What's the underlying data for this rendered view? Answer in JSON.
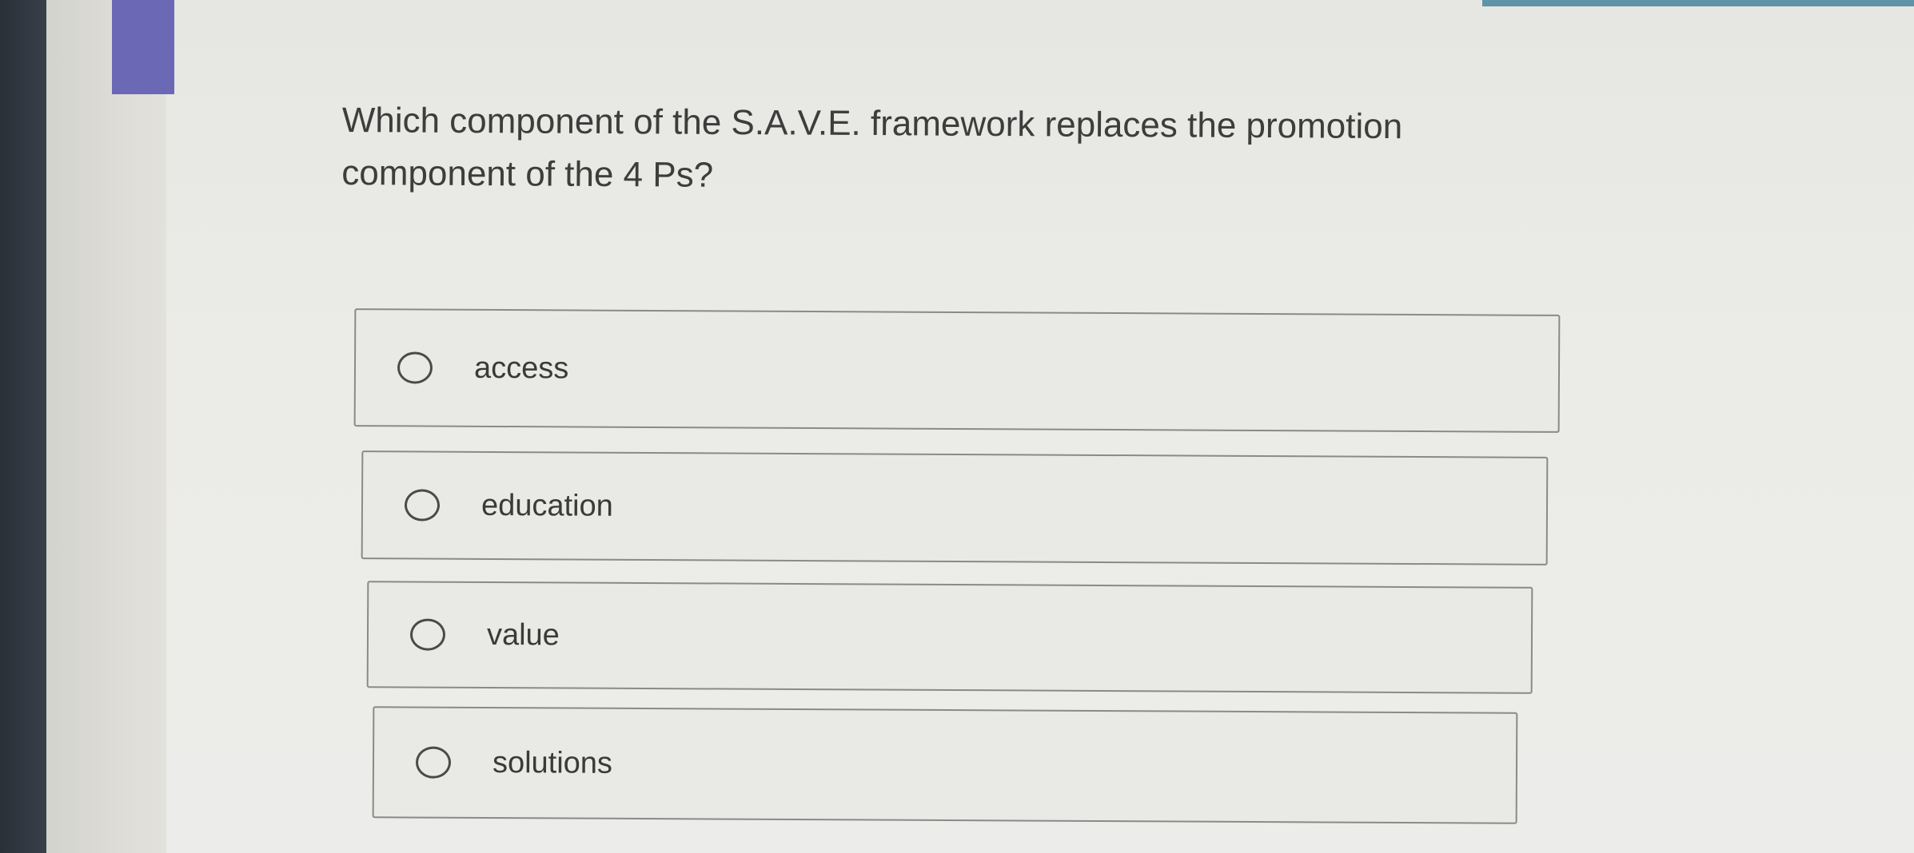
{
  "question": {
    "text_line": "Which component of the S.A.V.E. framework replaces the promotion component of the 4 Ps?"
  },
  "options": [
    {
      "label": "access",
      "selected": false
    },
    {
      "label": "education",
      "selected": false
    },
    {
      "label": "value",
      "selected": false
    },
    {
      "label": "solutions",
      "selected": false
    }
  ],
  "colors": {
    "accent": "#6b68b6",
    "background": "#ebebe7",
    "text": "#3d3d3d",
    "border": "#8a8a88"
  }
}
